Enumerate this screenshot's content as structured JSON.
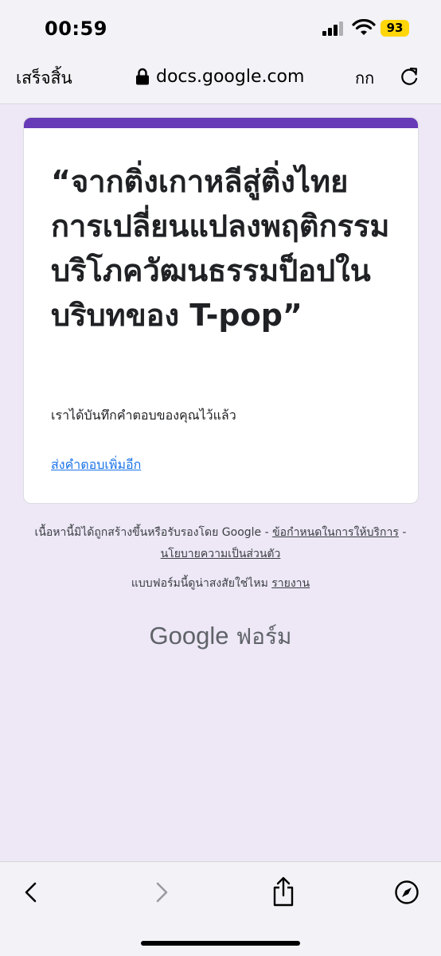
{
  "status_bar": {
    "time": "00:59",
    "battery": "93"
  },
  "browser": {
    "done_label": "เสร็จสิ้น",
    "url": "docs.google.com",
    "text_size_label": "กก"
  },
  "form": {
    "title": "“จากติ่งเกาหลีสู่ติ่งไทย การเปลี่ยนแปลงพฤติกรรมบริโภควัฒนธรรมป็อปในบริบทของ T-pop”",
    "confirmation": "เราได้บันทึกคำตอบของคุณไว้แล้ว",
    "resubmit_link": "ส่งคำตอบเพิ่มอีก",
    "accent_color": "#673ab7"
  },
  "footer": {
    "disclaimer_prefix": "เนื้อหานี้มิได้ถูกสร้างขึ้นหรือรับรองโดย Google - ",
    "terms_link": "ข้อกำหนดในการให้บริการ",
    "separator": " - ",
    "privacy_link": "นโยบายความเป็นส่วนตัว",
    "report_question": "แบบฟอร์มนี้ดูน่าสงสัยใช่ไหม ",
    "report_link": "รายงาน",
    "brand_google": "Google",
    "brand_forms": " ฟอร์ม"
  }
}
